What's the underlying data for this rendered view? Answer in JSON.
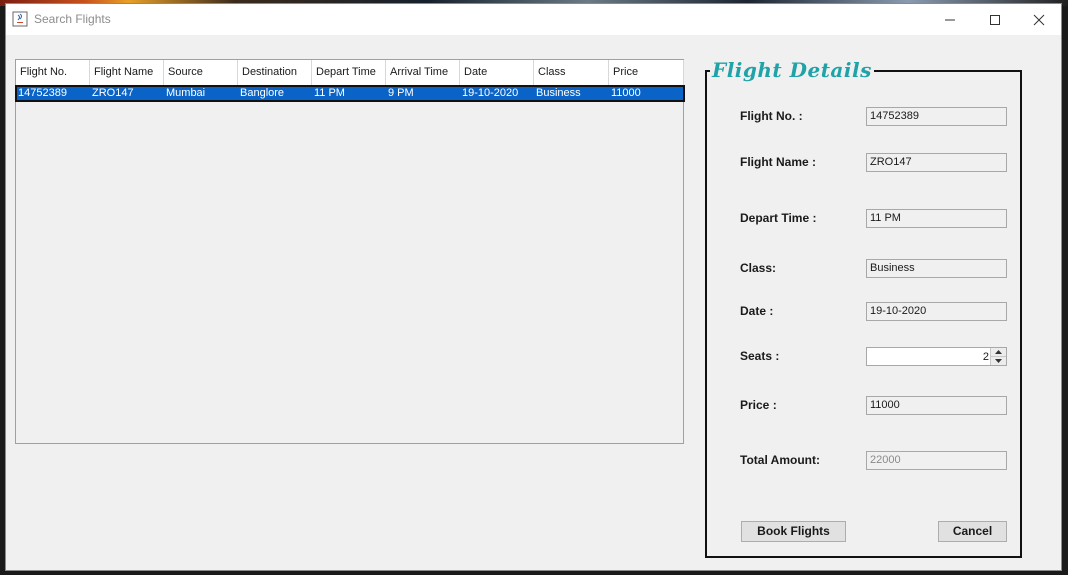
{
  "window": {
    "title": "Search Flights",
    "icon": "java-app-icon"
  },
  "table": {
    "columns": [
      "Flight No.",
      "Flight Name",
      "Source",
      "Destination",
      "Depart Time",
      "Arrival Time",
      "Date",
      "Class",
      "Price"
    ],
    "rows": [
      [
        "14752389",
        "ZRO147",
        "Mumbai",
        "Banglore",
        "11 PM",
        "9 PM",
        "19-10-2020",
        "Business",
        "11000"
      ]
    ],
    "selected_row_color": "#0a64c8"
  },
  "details": {
    "title": "Flight Details",
    "title_color": "#1fa3a8",
    "flight_no": {
      "label": "Flight No. :",
      "value": "14752389"
    },
    "flight_name": {
      "label": "Flight Name :",
      "value": "ZRO147"
    },
    "depart_time": {
      "label": "Depart Time :",
      "value": "11 PM"
    },
    "class": {
      "label": "Class:",
      "value": "Business"
    },
    "date": {
      "label": "Date :",
      "value": "19-10-2020"
    },
    "seats": {
      "label": "Seats :",
      "value": "2"
    },
    "price": {
      "label": "Price :",
      "value": "11000"
    },
    "total_amount": {
      "label": "Total Amount:",
      "value": "22000"
    }
  },
  "buttons": {
    "book": "Book Flights",
    "cancel": "Cancel"
  }
}
